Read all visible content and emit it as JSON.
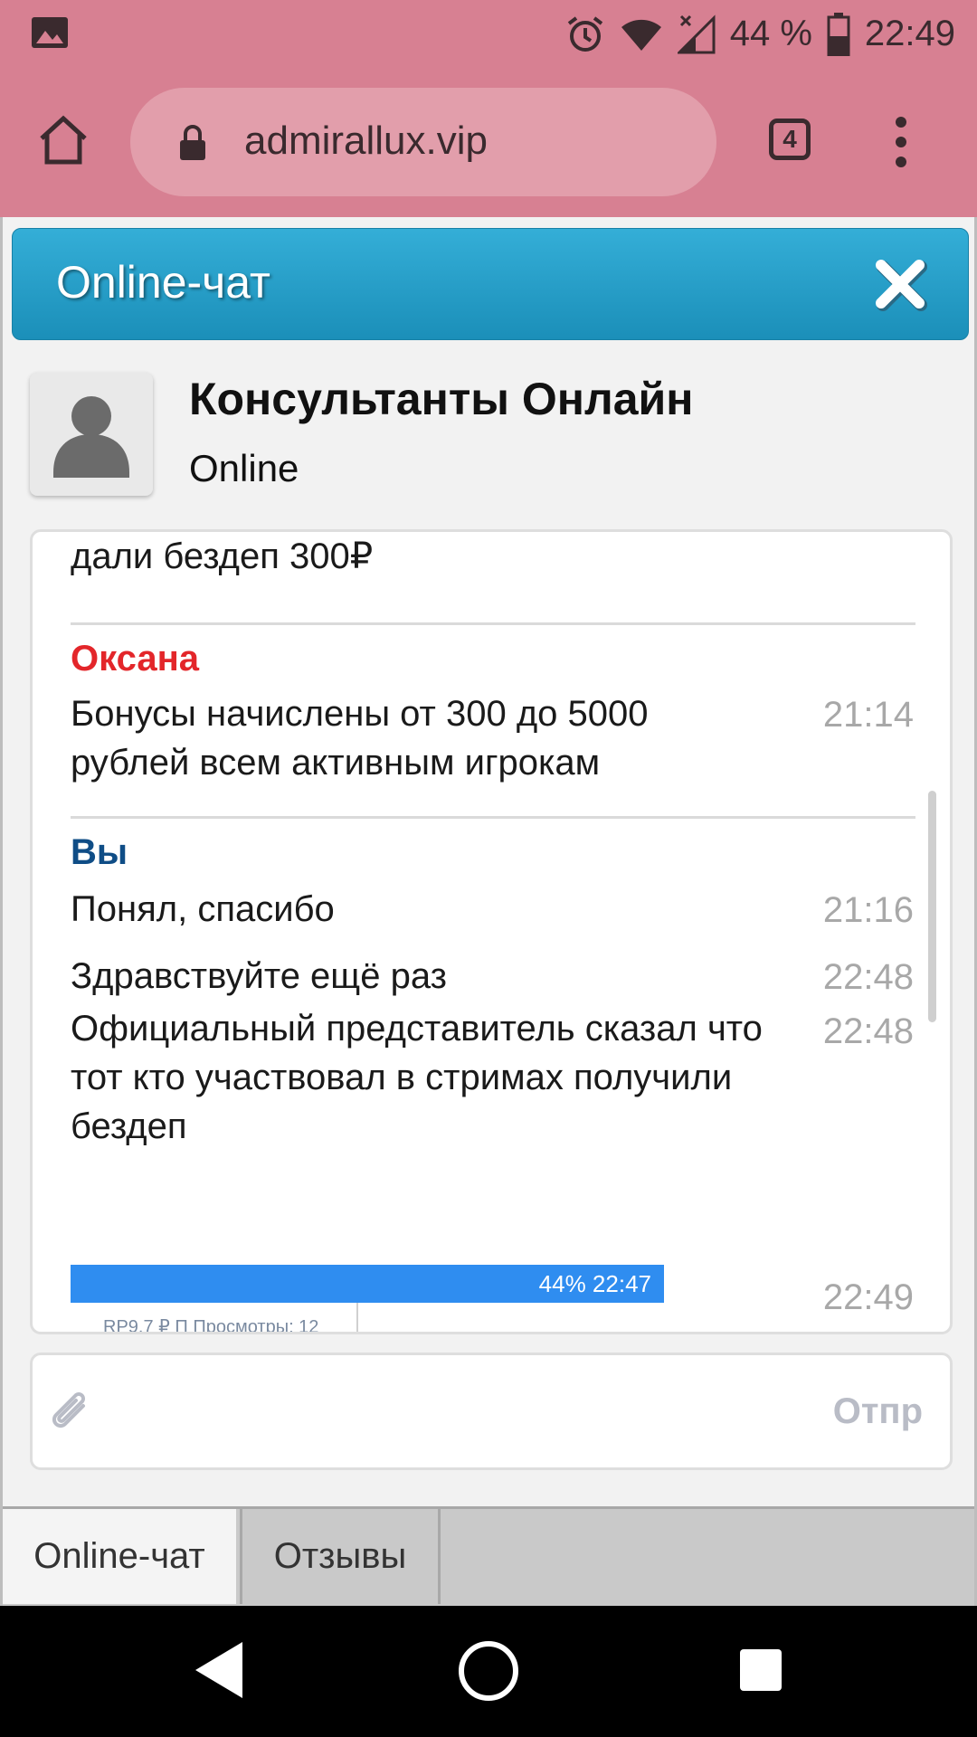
{
  "status_bar": {
    "battery": "44 %",
    "time": "22:49"
  },
  "browser": {
    "url": "admirallux.vip",
    "tab_count": "4"
  },
  "chat": {
    "title": "Online-чат",
    "consultant_name": "Консультанты Онлайн",
    "consultant_status": "Online",
    "messages": [
      {
        "text": "дали бездеп 300₽"
      },
      {
        "author": "Оксана",
        "author_color": "#e3262a",
        "text": "Бонусы начислены от 300 до 5000 рублей всем активным игрокам",
        "time": "21:14"
      },
      {
        "author": "Вы",
        "author_color": "#0f4d86",
        "text": "Понял, спасибо",
        "time": "21:16"
      },
      {
        "text": "Здравствуйте ещё раз",
        "time": "22:48"
      },
      {
        "text": "Официальный представитель сказал что тот кто участвовал в стримах получили бездеп",
        "time": "22:48"
      },
      {
        "attachment_status_text": "44%  22:47",
        "attachment_body_text": "RP9.7 ₽ П Просмотры: 12",
        "time": "22:49"
      }
    ],
    "send_label": "Отпр",
    "tabs": [
      {
        "label": "Online-чат",
        "active": true
      },
      {
        "label": "Отзывы",
        "active": false
      }
    ]
  }
}
